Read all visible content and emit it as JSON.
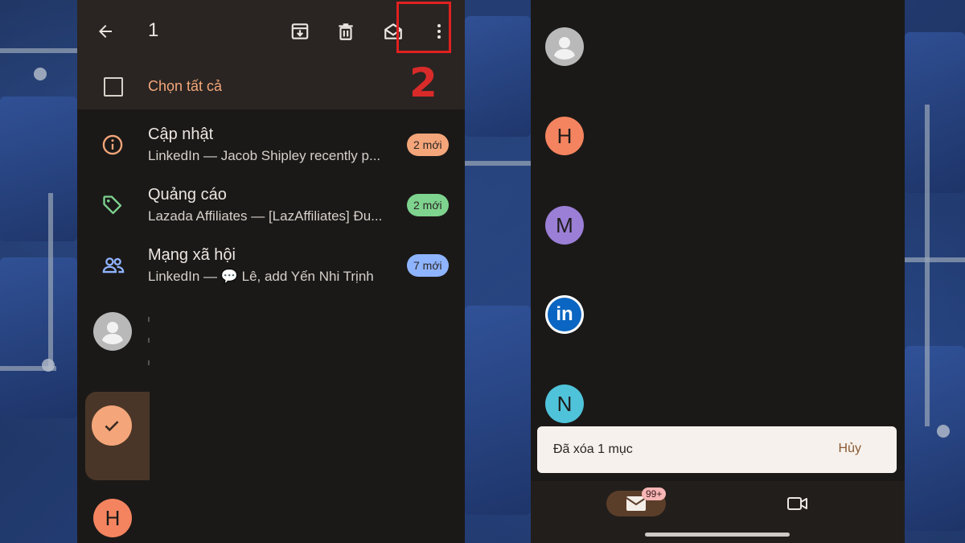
{
  "left": {
    "header": {
      "selected_count": "1",
      "icons": [
        "back-arrow-icon",
        "archive-icon",
        "trash-icon",
        "mark-read-icon",
        "more-vert-icon"
      ]
    },
    "annotation": {
      "step_number": "2",
      "color": "#d92a2a"
    },
    "select_all_label": "Chọn tất cả",
    "categories": [
      {
        "title": "Cập nhật",
        "subtitle": "LinkedIn — Jacob Shipley recently p...",
        "badge": "2 mới",
        "badge_color": "#f4a67a",
        "icon": "info-icon",
        "icon_color": "#f4a67a"
      },
      {
        "title": "Quảng cáo",
        "subtitle": "Lazada Affiliates — [LazAffiliates] Đu...",
        "badge": "2 mới",
        "badge_color": "#7ed38f",
        "icon": "tag-icon",
        "icon_color": "#7ed38f"
      },
      {
        "title": "Mạng xã hội",
        "subtitle": "LinkedIn — 💬 Lê, add Yến Nhi Trịnh",
        "badge": "7 mới",
        "badge_color": "#8fb4ff",
        "icon": "people-icon",
        "icon_color": "#8fb4ff"
      }
    ],
    "avatars": [
      {
        "type": "person",
        "letter": ""
      },
      {
        "type": "checked",
        "letter": ""
      },
      {
        "type": "letter",
        "letter": "H",
        "color": "#f4845f"
      }
    ]
  },
  "right": {
    "avatars": [
      {
        "type": "person",
        "letter": ""
      },
      {
        "letter": "H",
        "color": "#f4845f"
      },
      {
        "letter": "M",
        "color": "#9b7fd6"
      },
      {
        "letter": "in",
        "color": "#0a66c2"
      },
      {
        "letter": "N",
        "color": "#4fc3d9"
      }
    ],
    "snackbar": {
      "message": "Đã xóa 1 mục",
      "action": "Hủy"
    },
    "bottom_nav": {
      "mail_badge": "99+",
      "icons": [
        "mail-icon",
        "video-icon"
      ]
    }
  }
}
